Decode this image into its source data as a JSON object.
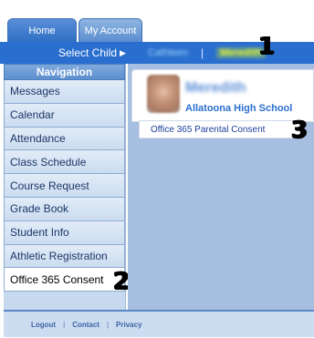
{
  "tabs": [
    "Home",
    "My Account"
  ],
  "child_bar": {
    "select_child_label": "Select Child",
    "caret": "▶",
    "child_1": "Cathleen",
    "separator": "|",
    "child_2": "Meredith"
  },
  "markers": {
    "m1": "1",
    "m2": "2",
    "m3": "3"
  },
  "navigation": {
    "title": "Navigation",
    "items": [
      "Messages",
      "Calendar",
      "Attendance",
      "Class Schedule",
      "Course Request",
      "Grade Book",
      "Student Info",
      "Athletic Registration",
      "Office 365 Consent"
    ]
  },
  "student": {
    "name": "Meredith",
    "school": "Allatoona High School"
  },
  "consent_link": "Office 365 Parental Consent",
  "footer": {
    "logout": "Logout",
    "contact": "Contact",
    "privacy": "Privacy",
    "separator": "|"
  },
  "colors": {
    "child_bar_bg": "#2a6fd0",
    "selected_child": "#dff03a",
    "main_panel_bg": "#a6bedf",
    "sidebar_bg": "#c7d9ef"
  }
}
